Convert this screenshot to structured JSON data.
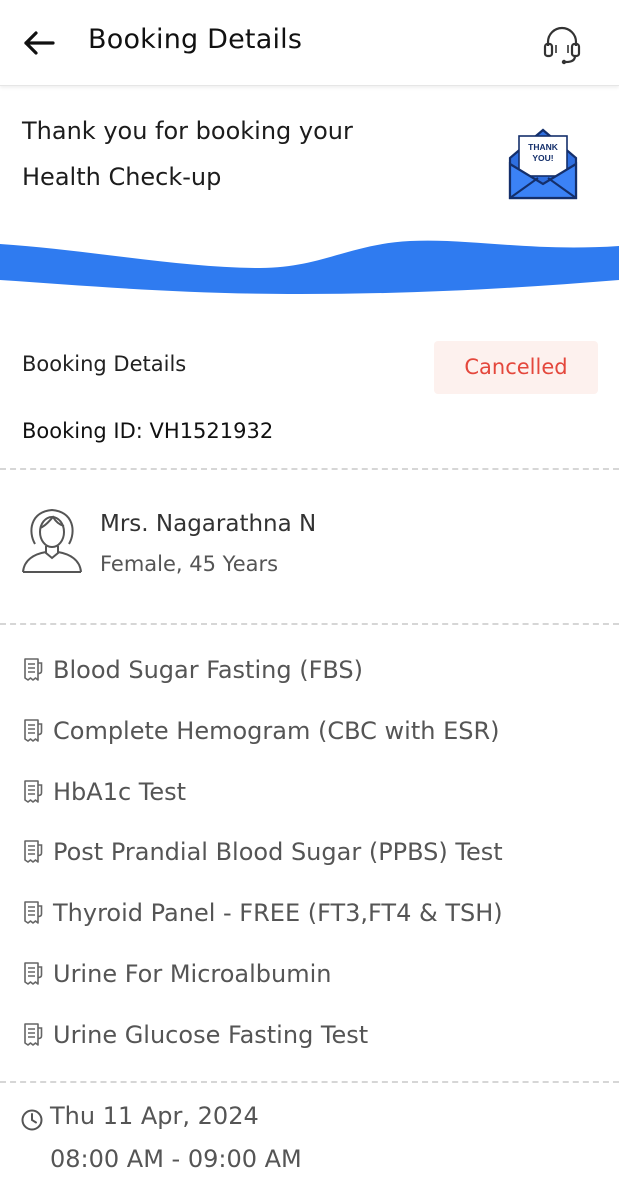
{
  "header": {
    "title": "Booking Details",
    "back_icon": "arrow-left-icon",
    "support_icon": "headset-icon"
  },
  "banner": {
    "line1": "Thank you for booking your",
    "line2": "Health Check-up",
    "envelope_text_1": "THANK",
    "envelope_text_2": "YOU!",
    "wave_color": "#2f7bf0"
  },
  "booking": {
    "section_label": "Booking Details",
    "status": "Cancelled",
    "status_color": "#e4473c",
    "id_label": "Booking ID: ",
    "id_value": "VH1521932"
  },
  "patient": {
    "name": "Mrs. Nagarathna N",
    "meta": "Female, 45 Years",
    "avatar_icon": "woman-avatar-icon"
  },
  "tests": [
    {
      "label": "Blood Sugar Fasting (FBS)"
    },
    {
      "label": "Complete Hemogram (CBC with ESR)"
    },
    {
      "label": "HbA1c Test"
    },
    {
      "label": "Post Prandial Blood Sugar (PPBS) Test"
    },
    {
      "label": "Thyroid Panel - FREE (FT3,FT4 & TSH)"
    },
    {
      "label": "Urine For Microalbumin"
    },
    {
      "label": "Urine Glucose Fasting Test"
    }
  ],
  "slot": {
    "date": "Thu 11 Apr, 2024",
    "time": "08:00 AM - 09:00 AM",
    "icon": "clock-icon"
  }
}
